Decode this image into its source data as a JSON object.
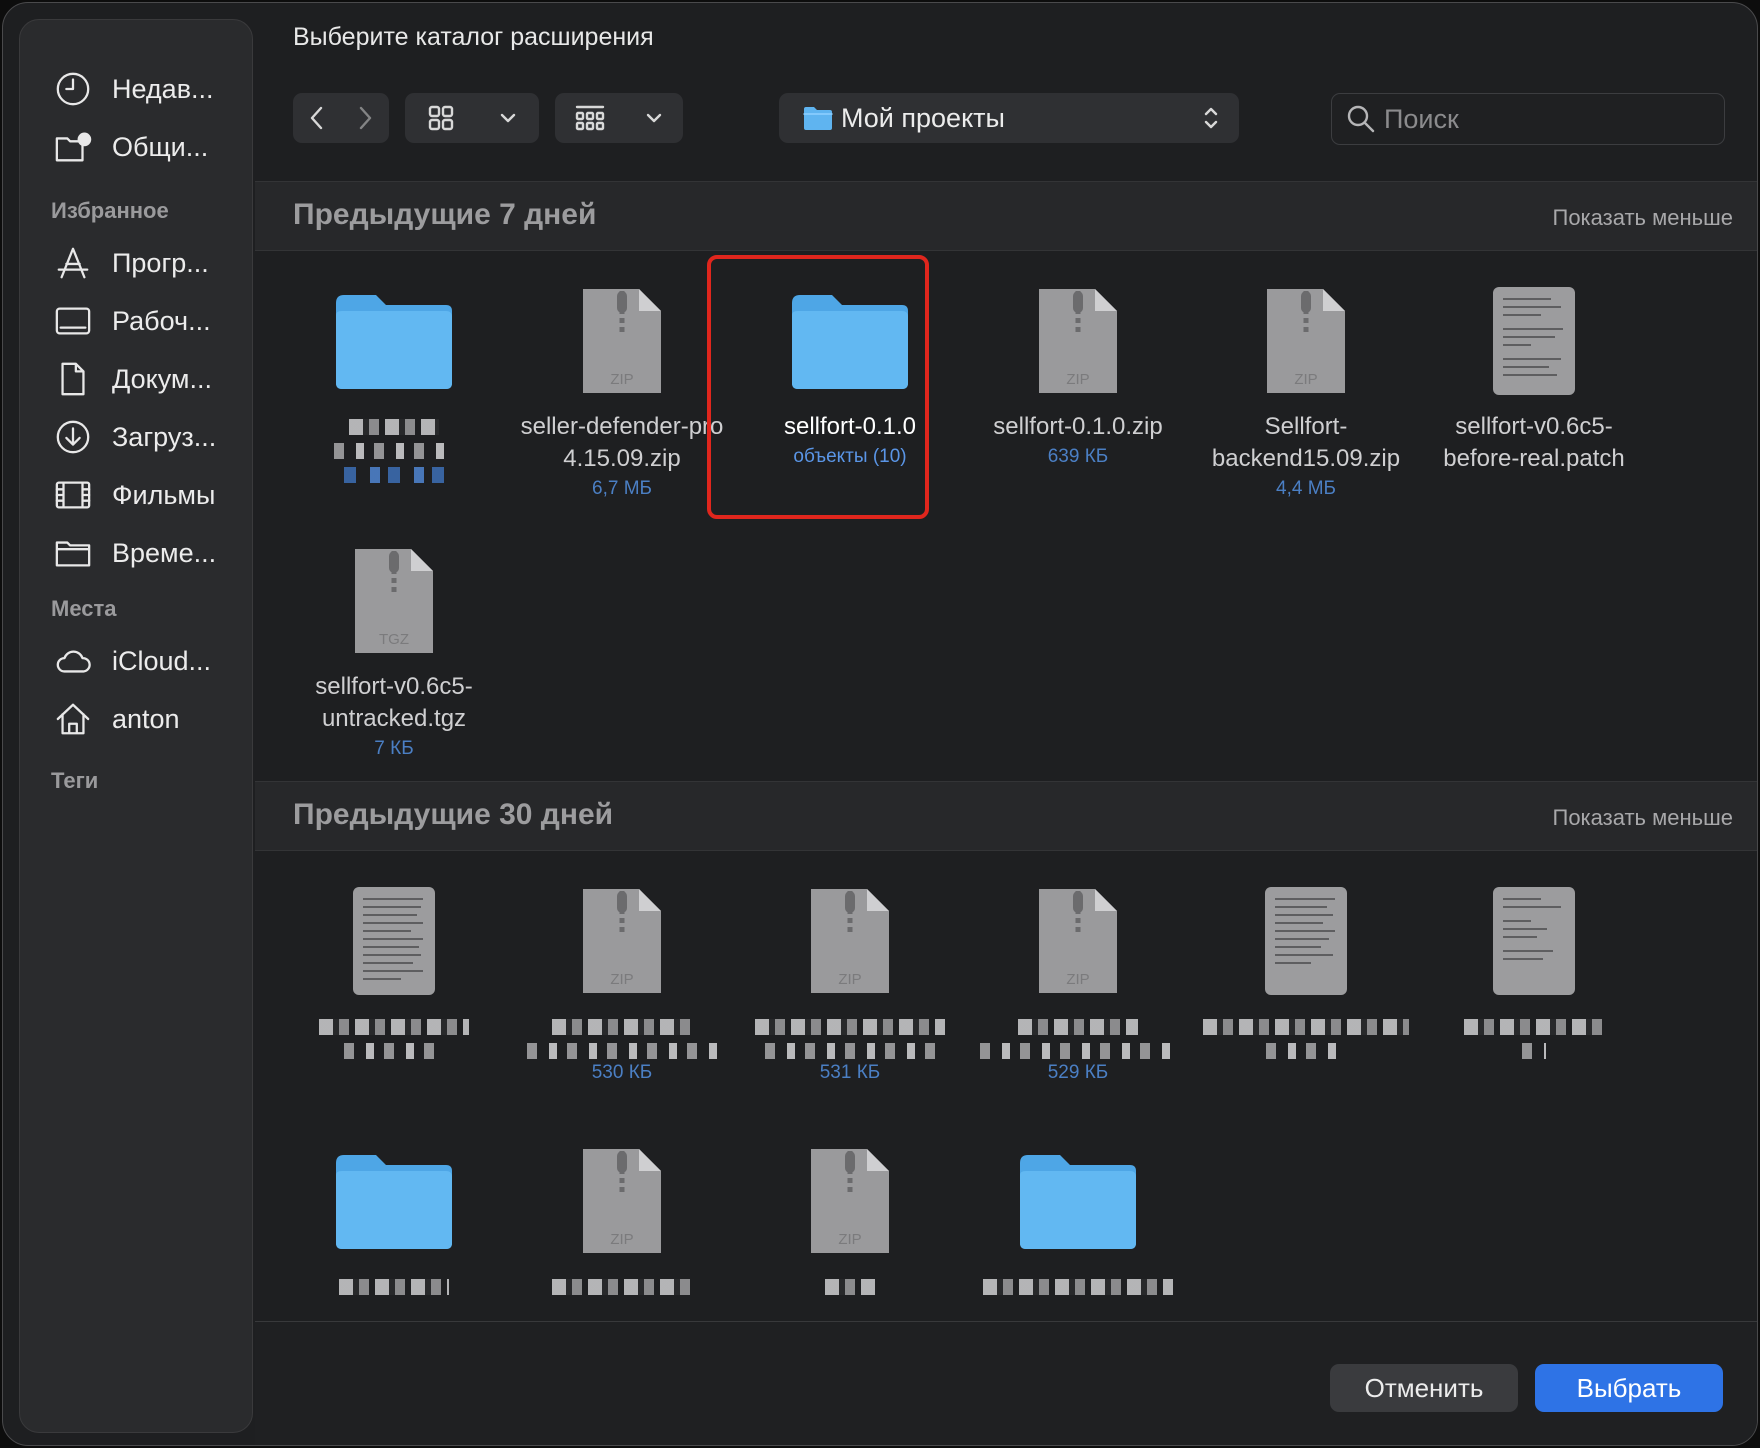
{
  "dialog": {
    "title": "Выберите каталог расширения"
  },
  "sidebar": {
    "recent": [
      {
        "label": "Недав...",
        "icon": "clock-icon"
      },
      {
        "label": "Общи...",
        "icon": "shared-folder-icon"
      }
    ],
    "favorites_header": "Избранное",
    "favorites": [
      {
        "label": "Прогр...",
        "icon": "applications-icon"
      },
      {
        "label": "Рабоч...",
        "icon": "desktop-icon"
      },
      {
        "label": "Докум...",
        "icon": "document-icon"
      },
      {
        "label": "Загруз...",
        "icon": "download-icon"
      },
      {
        "label": "Фильмы",
        "icon": "film-icon"
      },
      {
        "label": "Време...",
        "icon": "folder-icon"
      }
    ],
    "places_header": "Места",
    "places": [
      {
        "label": "iCloud...",
        "icon": "cloud-icon"
      },
      {
        "label": "anton",
        "icon": "home-icon"
      }
    ],
    "tags_header": "Теги"
  },
  "toolbar": {
    "location": "Мой проекты",
    "search_placeholder": "Поиск"
  },
  "sections": [
    {
      "title": "Предыдущие 7 дней",
      "toggle": "Показать меньше",
      "items": [
        {
          "type": "folder",
          "name": "",
          "sub": ""
        },
        {
          "type": "zip",
          "badge": "ZIP",
          "name": "seller-defender-pro 4.15.09.zip",
          "sub": "6,7 МБ"
        },
        {
          "type": "folder",
          "name": "sellfort-0.1.0",
          "sub": "объекты (10)",
          "selected": true
        },
        {
          "type": "zip",
          "badge": "ZIP",
          "name": "sellfort-0.1.0.zip",
          "sub": "639 КБ"
        },
        {
          "type": "zip",
          "badge": "ZIP",
          "name": "Sellfort-backend15.09.zip",
          "sub": "4,4 МБ"
        },
        {
          "type": "doc",
          "name": "sellfort-v0.6c5-before-real.patch",
          "sub": ""
        },
        {
          "type": "zip",
          "badge": "TGZ",
          "name": "sellfort-v0.6c5-untracked.tgz",
          "sub": "7 КБ"
        }
      ]
    },
    {
      "title": "Предыдущие 30 дней",
      "toggle": "Показать меньше",
      "items": [
        {
          "type": "doc",
          "sub": ""
        },
        {
          "type": "zip",
          "badge": "ZIP",
          "sub": "530 КБ"
        },
        {
          "type": "zip",
          "badge": "ZIP",
          "sub": "531 КБ"
        },
        {
          "type": "zip",
          "badge": "ZIP",
          "sub": "529 КБ"
        },
        {
          "type": "doc",
          "sub": ""
        },
        {
          "type": "doc",
          "sub": ""
        },
        {
          "type": "folder",
          "sub": ""
        },
        {
          "type": "zip",
          "badge": "ZIP",
          "sub": ""
        },
        {
          "type": "zip",
          "badge": "ZIP",
          "sub": ""
        },
        {
          "type": "folder",
          "sub": ""
        }
      ]
    }
  ],
  "footer": {
    "cancel": "Отменить",
    "confirm": "Выбрать"
  },
  "colors": {
    "accent": "#2e73e6",
    "selection_outline": "#e0261d",
    "folder": "#5fb4f0"
  }
}
